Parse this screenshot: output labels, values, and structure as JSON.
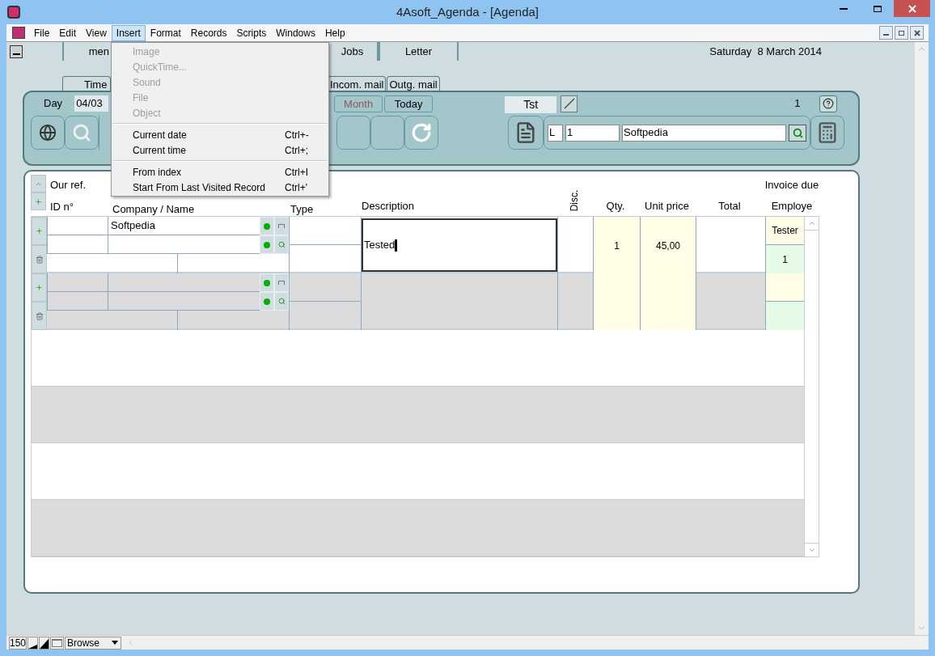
{
  "window": {
    "title": "4Asoft_Agenda - [Agenda]"
  },
  "menu_bar": [
    {
      "label": "File",
      "selected": false
    },
    {
      "label": "Edit",
      "selected": false
    },
    {
      "label": "View",
      "selected": false
    },
    {
      "label": "Insert",
      "selected": true
    },
    {
      "label": "Format",
      "selected": false
    },
    {
      "label": "Records",
      "selected": false
    },
    {
      "label": "Scripts",
      "selected": false
    },
    {
      "label": "Windows",
      "selected": false
    },
    {
      "label": "Help",
      "selected": false
    }
  ],
  "insert_menu": [
    {
      "kind": "item",
      "label": "Image",
      "disabled": true
    },
    {
      "kind": "item",
      "label": "QuickTime...",
      "disabled": true
    },
    {
      "kind": "item",
      "label": "Sound",
      "disabled": true
    },
    {
      "kind": "item",
      "label": "File",
      "disabled": true
    },
    {
      "kind": "item",
      "label": "Object",
      "disabled": true
    },
    {
      "kind": "separator"
    },
    {
      "kind": "item",
      "label": "Current date",
      "shortcut": "Ctrl+-",
      "disabled": false
    },
    {
      "kind": "item",
      "label": "Current time",
      "shortcut": "Ctrl+;",
      "disabled": false
    },
    {
      "kind": "separator"
    },
    {
      "kind": "item",
      "label": "From index",
      "shortcut": "Ctrl+I",
      "disabled": false
    },
    {
      "kind": "item",
      "label": "Start From Last Visited Record",
      "shortcut": "Ctrl+'",
      "disabled": false
    }
  ],
  "nav_tabs": [
    {
      "label": "men"
    },
    {
      "label": "Jobs"
    },
    {
      "label": "Letter"
    }
  ],
  "date": "Saturday  8 March 2014",
  "sub_tabs": [
    {
      "label": "Time"
    },
    {
      "label": "Incom. mail"
    },
    {
      "label": "Outg. mail"
    }
  ],
  "toolbar": {
    "period_label": "Day",
    "date_value": "04/03",
    "buttons": [
      {
        "label": "Month",
        "disabled": true
      },
      {
        "label": "Today",
        "disabled": false
      }
    ],
    "view_tab": "Tst",
    "count": "1",
    "record": {
      "prefix": "L",
      "number": "1",
      "name": "Softpedia"
    }
  },
  "table": {
    "headers": {
      "our_ref": "Our ref.",
      "id": "ID n°",
      "company": "Company / Name",
      "type": "Type",
      "description": "Description",
      "disc": "Disc.",
      "qty": "Qty.",
      "unit_price": "Unit price",
      "total": "Total",
      "invoice_due": "Invoice due",
      "employee": "Employe"
    },
    "rows": [
      {
        "kind": "record",
        "company": "Softpedia",
        "description": "Tested",
        "editing": true,
        "qty": "1",
        "unit_price": "45,00",
        "employee": "Tester",
        "employee_no": "1"
      },
      {
        "kind": "record",
        "editing": false
      },
      {
        "kind": "blank"
      },
      {
        "kind": "blank"
      },
      {
        "kind": "blank"
      },
      {
        "kind": "blank"
      }
    ]
  },
  "status_bar": {
    "zoom": "150",
    "mode": "Browse"
  }
}
